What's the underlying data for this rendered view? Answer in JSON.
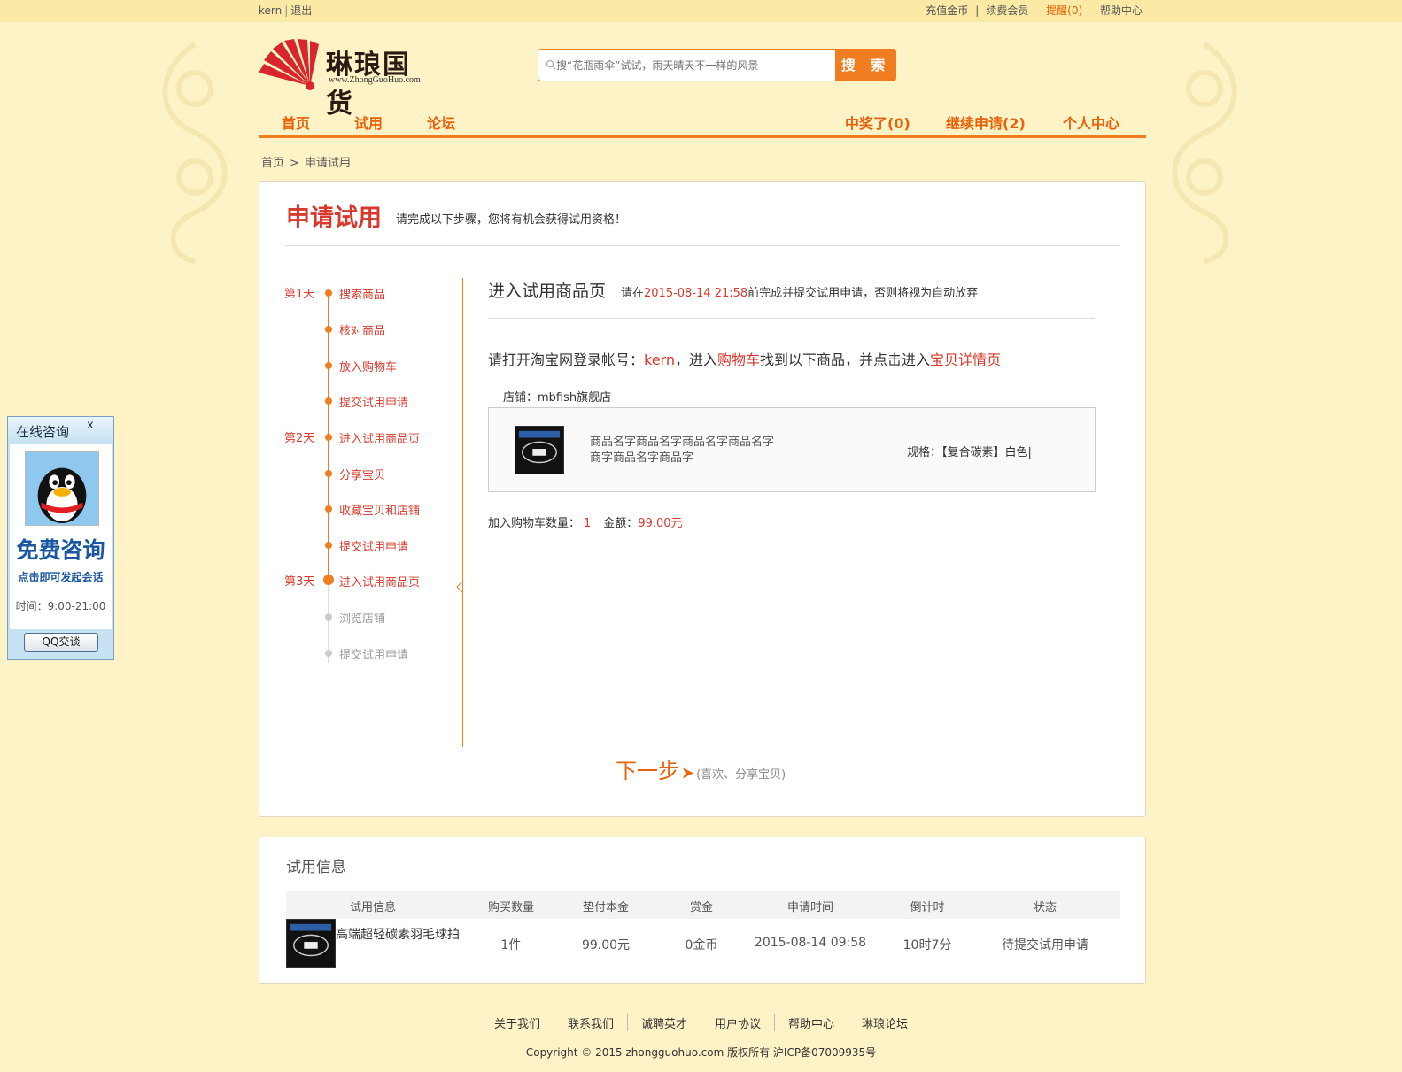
{
  "topbar": {
    "username": "kern",
    "logout": "退出",
    "recharge": "充值金币",
    "renew": "续费会员",
    "remind": "提醒(0)",
    "help": "帮助中心"
  },
  "logo": {
    "name": "琳琅国货",
    "url": "www.ZhongGuoHuo.com"
  },
  "search": {
    "placeholder": "搜“花瓶雨伞”试试，雨天晴天不一样的风景",
    "button": "搜 索"
  },
  "nav": {
    "home": "首页",
    "trial": "试用",
    "forum": "论坛",
    "won": "中奖了(0)",
    "continue": "继续申请(2)",
    "personal": "个人中心"
  },
  "breadcrumb": {
    "home": "首页",
    "sep": ">",
    "current": "申请试用"
  },
  "apply": {
    "title": "申请试用",
    "subtitle": "请完成以下步骤，您将有机会获得试用资格！",
    "steps": [
      {
        "day": "第1天",
        "label": "搜索商品"
      },
      {
        "day": "",
        "label": "核对商品"
      },
      {
        "day": "",
        "label": "放入购物车"
      },
      {
        "day": "",
        "label": "提交试用申请"
      },
      {
        "day": "第2天",
        "label": "进入试用商品页"
      },
      {
        "day": "",
        "label": "分享宝贝"
      },
      {
        "day": "",
        "label": "收藏宝贝和店铺"
      },
      {
        "day": "",
        "label": "提交试用申请"
      },
      {
        "day": "第3天",
        "label": "进入试用商品页"
      },
      {
        "day": "",
        "label": "浏览店铺"
      },
      {
        "day": "",
        "label": "提交试用申请"
      }
    ],
    "heading": "进入试用商品页",
    "deadline_pre": "请在",
    "deadline_time": "2015-08-14 21:58",
    "deadline_post": "前完成并提交试用申请，否则将视为自动放弃",
    "instr_1": "请打开淘宝网登录帐号：",
    "instr_account": "kern",
    "instr_2": "，进入",
    "instr_cart": "购物车",
    "instr_3": "找到以下商品，并点击进入",
    "instr_detail": "宝贝详情页",
    "shop": "店铺：mbfish旗舰店",
    "goods_name": "商品名字商品名字商品名字商品名字商字商品名字商品字",
    "spec": "规格：【复合碳素】白色|",
    "qty_label": "加入购物车数量：",
    "qty": "1",
    "amount_label": "金额：",
    "amount": "99.00元",
    "next": "下一步",
    "next_arrow": "➤",
    "next_hint": "(喜欢、分享宝贝)"
  },
  "trial_info": {
    "title": "试用信息",
    "headers": [
      "试用信息",
      "购买数量",
      "垫付本金",
      "赏金",
      "申请时间",
      "倒计时",
      "状态"
    ],
    "row": {
      "name": "高端超轻碳素羽毛球拍",
      "qty": "1件",
      "principal": "99.00元",
      "reward": "0金币",
      "time": "2015-08-14 09:58",
      "countdown": "10时7分",
      "status": "待提交试用申请"
    }
  },
  "footer": {
    "links": [
      "关于我们",
      "联系我们",
      "诚聘英才",
      "用户协议",
      "帮助中心",
      "琳琅论坛"
    ],
    "copyright": "Copyright © 2015 zhongguohuo.com 版权所有 沪ICP备07009935号"
  },
  "consult": {
    "title": "在线咨询",
    "close": "x",
    "free": "免费咨询",
    "tap": "点击即可发起会话",
    "time": "时间：9:00-21:00",
    "button": "QQ交谈"
  },
  "colors": {
    "accent": "#f07d1f",
    "red": "#d8392c",
    "background": "#fdf3c6"
  }
}
